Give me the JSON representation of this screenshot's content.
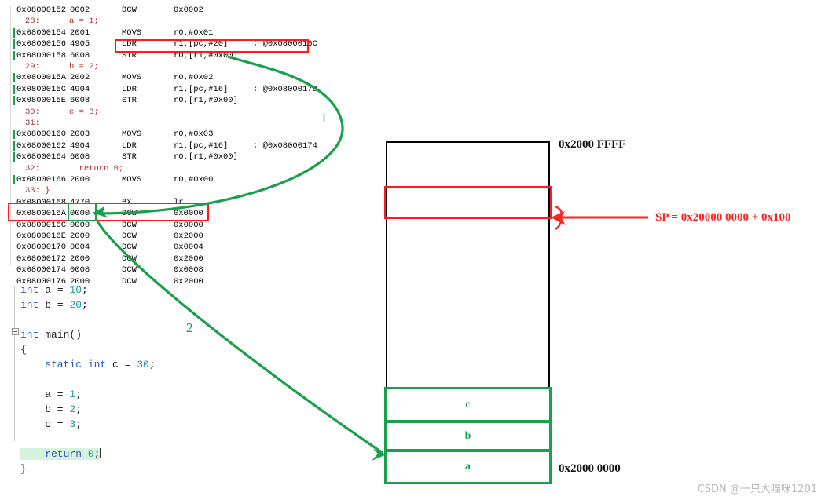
{
  "colors": {
    "red": "#ff1b1b",
    "green": "#19a04a",
    "source_line": "#b23030",
    "keyword": "#2b57c4",
    "number": "#1a9a9a",
    "highlight": "#d7f3df",
    "watermark": "#b9b9b9"
  },
  "disassembly": {
    "rows": [
      {
        "kind": "code",
        "addr": "0x08000152",
        "hex": "0002",
        "mn": "DCW",
        "op": "0x0002",
        "cmt": "",
        "mark": false
      },
      {
        "kind": "src",
        "line": "28:",
        "text": "a = 1;"
      },
      {
        "kind": "code",
        "addr": "0x08000154",
        "hex": "2001",
        "mn": "MOVS",
        "op": "r0,#0x01",
        "cmt": "",
        "mark": true
      },
      {
        "kind": "code",
        "addr": "0x08000156",
        "hex": "4905",
        "mn": "LDR",
        "op": "r1,[pc,#20]",
        "cmt": "; @0x0800016C",
        "mark": true
      },
      {
        "kind": "code",
        "addr": "0x08000158",
        "hex": "6008",
        "mn": "STR",
        "op": "r0,[r1,#0x00]",
        "cmt": "",
        "mark": true
      },
      {
        "kind": "src",
        "line": "29:",
        "text": "b = 2;"
      },
      {
        "kind": "code",
        "addr": "0x0800015A",
        "hex": "2002",
        "mn": "MOVS",
        "op": "r0,#0x02",
        "cmt": "",
        "mark": true
      },
      {
        "kind": "code",
        "addr": "0x0800015C",
        "hex": "4904",
        "mn": "LDR",
        "op": "r1,[pc,#16]",
        "cmt": "; @0x08000170",
        "mark": true
      },
      {
        "kind": "code",
        "addr": "0x0800015E",
        "hex": "6008",
        "mn": "STR",
        "op": "r0,[r1,#0x00]",
        "cmt": "",
        "mark": true
      },
      {
        "kind": "src",
        "line": "30:",
        "text": "c = 3;"
      },
      {
        "kind": "src",
        "line": "31:",
        "text": ""
      },
      {
        "kind": "code",
        "addr": "0x08000160",
        "hex": "2003",
        "mn": "MOVS",
        "op": "r0,#0x03",
        "cmt": "",
        "mark": true
      },
      {
        "kind": "code",
        "addr": "0x08000162",
        "hex": "4904",
        "mn": "LDR",
        "op": "r1,[pc,#16]",
        "cmt": "; @0x08000174",
        "mark": true
      },
      {
        "kind": "code",
        "addr": "0x08000164",
        "hex": "6008",
        "mn": "STR",
        "op": "r0,[r1,#0x00]",
        "cmt": "",
        "mark": true
      },
      {
        "kind": "src",
        "line": "32:",
        "text": "  return 0;"
      },
      {
        "kind": "code",
        "addr": "0x08000166",
        "hex": "2000",
        "mn": "MOVS",
        "op": "r0,#0x00",
        "cmt": "",
        "mark": true
      },
      {
        "kind": "src",
        "line": "33: }",
        "text": ""
      },
      {
        "kind": "code",
        "addr": "0x08000168",
        "hex": "4770",
        "mn": "BX",
        "op": "lr",
        "cmt": "",
        "mark": false
      },
      {
        "kind": "code",
        "addr": "0x0800016A",
        "hex": "0000",
        "mn": "DCW",
        "op": "0x0000",
        "cmt": "",
        "mark": false
      },
      {
        "kind": "code",
        "addr": "0x0800016C",
        "hex": "0000",
        "mn": "DCW",
        "op": "0x0000",
        "cmt": "",
        "mark": false
      },
      {
        "kind": "code",
        "addr": "0x0800016E",
        "hex": "2000",
        "mn": "DCW",
        "op": "0x2000",
        "cmt": "",
        "mark": false
      },
      {
        "kind": "code",
        "addr": "0x08000170",
        "hex": "0004",
        "mn": "DCW",
        "op": "0x0004",
        "cmt": "",
        "mark": false
      },
      {
        "kind": "code",
        "addr": "0x08000172",
        "hex": "2000",
        "mn": "DCW",
        "op": "0x2000",
        "cmt": "",
        "mark": false
      },
      {
        "kind": "code",
        "addr": "0x08000174",
        "hex": "0008",
        "mn": "DCW",
        "op": "0x0008",
        "cmt": "",
        "mark": false
      },
      {
        "kind": "code",
        "addr": "0x08000176",
        "hex": "2000",
        "mn": "DCW",
        "op": "0x2000",
        "cmt": "",
        "mark": false
      }
    ]
  },
  "source_code": {
    "lines": [
      [
        {
          "t": "int ",
          "c": "kw"
        },
        {
          "t": "a = ",
          "c": ""
        },
        {
          "t": "10",
          "c": "num"
        },
        {
          "t": ";",
          "c": ""
        }
      ],
      [
        {
          "t": "int ",
          "c": "kw"
        },
        {
          "t": "b = ",
          "c": ""
        },
        {
          "t": "20",
          "c": "num"
        },
        {
          "t": ";",
          "c": ""
        }
      ],
      [],
      [
        {
          "t": "int ",
          "c": "kw"
        },
        {
          "t": "main()",
          "c": ""
        }
      ],
      [
        {
          "t": "{",
          "c": ""
        }
      ],
      [
        {
          "t": "    static int ",
          "c": "kw"
        },
        {
          "t": "c = ",
          "c": ""
        },
        {
          "t": "30",
          "c": "num"
        },
        {
          "t": ";",
          "c": ""
        }
      ],
      [],
      [
        {
          "t": "    a = ",
          "c": ""
        },
        {
          "t": "1",
          "c": "num"
        },
        {
          "t": ";",
          "c": ""
        }
      ],
      [
        {
          "t": "    b = ",
          "c": ""
        },
        {
          "t": "2",
          "c": "num"
        },
        {
          "t": ";",
          "c": ""
        }
      ],
      [
        {
          "t": "    c = ",
          "c": ""
        },
        {
          "t": "3",
          "c": "num"
        },
        {
          "t": ";",
          "c": ""
        }
      ],
      [],
      [
        {
          "t": "    return ",
          "c": "kw hl"
        },
        {
          "t": "0",
          "c": "num hl"
        },
        {
          "t": ";",
          "c": "hl"
        }
      ],
      [
        {
          "t": "}",
          "c": ""
        }
      ]
    ]
  },
  "memory_diagram": {
    "top_address_label": "0x2000 FFFF",
    "bottom_address_label": "0x2000 0000",
    "sp_label": "SP = 0x20000 0000 + 0x100",
    "variable_cells": [
      {
        "label": "c"
      },
      {
        "label": "b"
      },
      {
        "label": "a"
      }
    ]
  },
  "annotations": {
    "arrow_1_label": "1",
    "arrow_2_label": "2"
  },
  "watermark": {
    "text": "CSDN @一只大喵咪1201"
  }
}
